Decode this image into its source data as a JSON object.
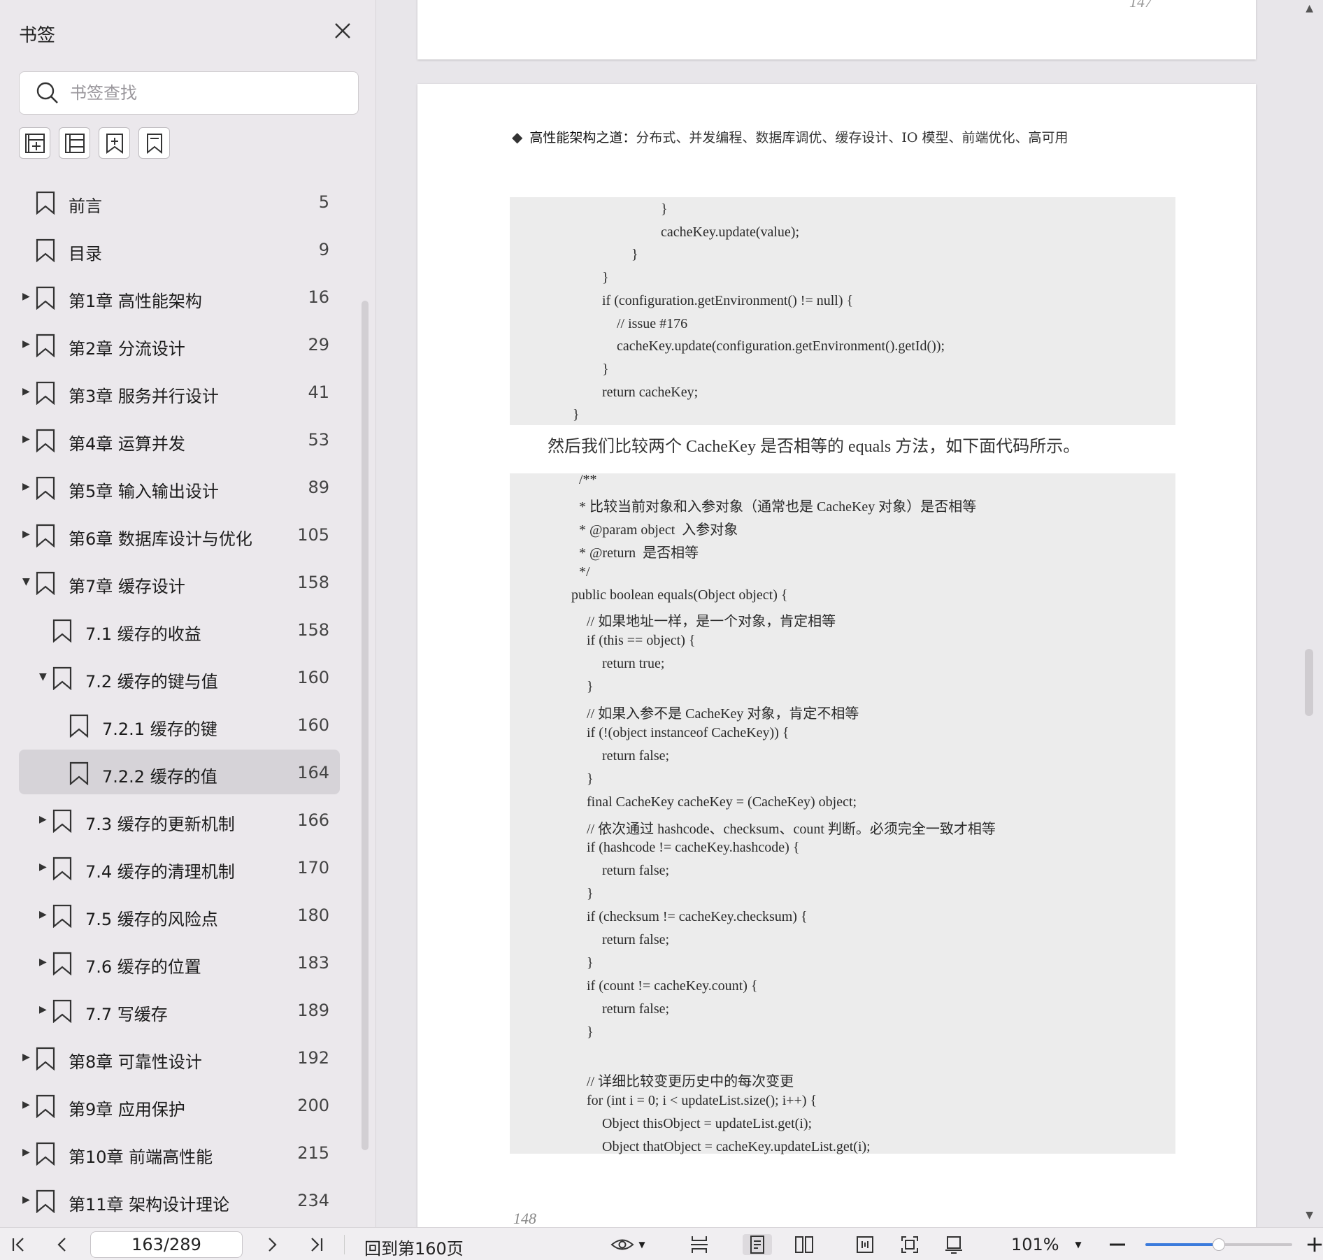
{
  "sidebar": {
    "title": "书签",
    "search_placeholder": "书签查找",
    "tools": [
      "add-bookmark-icon",
      "collapse-all-icon",
      "expand-all-icon",
      "bookmark-icon"
    ],
    "items": [
      {
        "label": "前言",
        "page": "5",
        "level": 0,
        "arrow": "none"
      },
      {
        "label": "目录",
        "page": "9",
        "level": 0,
        "arrow": "none"
      },
      {
        "label": "第1章 高性能架构",
        "page": "16",
        "level": 0,
        "arrow": "right"
      },
      {
        "label": "第2章 分流设计",
        "page": "29",
        "level": 0,
        "arrow": "right"
      },
      {
        "label": "第3章 服务并行设计",
        "page": "41",
        "level": 0,
        "arrow": "right"
      },
      {
        "label": "第4章 运算并发",
        "page": "53",
        "level": 0,
        "arrow": "right"
      },
      {
        "label": "第5章 输入输出设计",
        "page": "89",
        "level": 0,
        "arrow": "right"
      },
      {
        "label": "第6章 数据库设计与优化",
        "page": "105",
        "level": 0,
        "arrow": "right"
      },
      {
        "label": "第7章 缓存设计",
        "page": "158",
        "level": 0,
        "arrow": "down"
      },
      {
        "label": "7.1 缓存的收益",
        "page": "158",
        "level": 1,
        "arrow": "none"
      },
      {
        "label": "7.2 缓存的键与值",
        "page": "160",
        "level": 1,
        "arrow": "down"
      },
      {
        "label": "7.2.1 缓存的键",
        "page": "160",
        "level": 2,
        "arrow": "none"
      },
      {
        "label": "7.2.2 缓存的值",
        "page": "164",
        "level": 2,
        "arrow": "none",
        "active": true
      },
      {
        "label": "7.3 缓存的更新机制",
        "page": "166",
        "level": 1,
        "arrow": "right"
      },
      {
        "label": "7.4 缓存的清理机制",
        "page": "170",
        "level": 1,
        "arrow": "right"
      },
      {
        "label": "7.5 缓存的风险点",
        "page": "180",
        "level": 1,
        "arrow": "right"
      },
      {
        "label": "7.6 缓存的位置",
        "page": "183",
        "level": 1,
        "arrow": "right"
      },
      {
        "label": "7.7 写缓存",
        "page": "189",
        "level": 1,
        "arrow": "right"
      },
      {
        "label": "第8章 可靠性设计",
        "page": "192",
        "level": 0,
        "arrow": "right"
      },
      {
        "label": "第9章 应用保护",
        "page": "200",
        "level": 0,
        "arrow": "right"
      },
      {
        "label": "第10章 前端高性能",
        "page": "215",
        "level": 0,
        "arrow": "right"
      },
      {
        "label": "第11章 架构设计理论",
        "page": "234",
        "level": 0,
        "arrow": "right"
      }
    ]
  },
  "document": {
    "prev_page_number": "147",
    "header_bold": "高性能架构之道：",
    "header_rest": "分布式、并发编程、数据库调优、缓存设计、IO 模型、前端优化、高可用",
    "code_block_1": [
      {
        "t": "}",
        "i": 6
      },
      {
        "t": "cacheKey.update(value);",
        "i": 6
      },
      {
        "t": "}",
        "i": 4
      },
      {
        "t": "}",
        "i": 2
      },
      {
        "t": "if (configuration.getEnvironment() != null) {",
        "i": 2
      },
      {
        "t": "// issue #176",
        "i": 3
      },
      {
        "t": "cacheKey.update(configuration.getEnvironment().getId());",
        "i": 3
      },
      {
        "t": "}",
        "i": 2
      },
      {
        "t": "return cacheKey;",
        "i": 2
      },
      {
        "t": "}",
        "i": 0
      }
    ],
    "paragraph": "然后我们比较两个 CacheKey 是否相等的 equals 方法，如下面代码所示。",
    "code_block_2": [
      {
        "t": "/**",
        "i": 0.5
      },
      {
        "t": "* 比较当前对象和入参对象（通常也是 CacheKey 对象）是否相等",
        "i": 0.5
      },
      {
        "t": "* @param object  入参对象",
        "i": 0.5
      },
      {
        "t": "* @return  是否相等",
        "i": 0.5
      },
      {
        "t": "*/",
        "i": 0.5
      },
      {
        "t": "public boolean equals(Object object) {",
        "i": 0
      },
      {
        "t": "// 如果地址一样，是一个对象，肯定相等",
        "i": 1
      },
      {
        "t": "if (this == object) {",
        "i": 1
      },
      {
        "t": "return true;",
        "i": 2
      },
      {
        "t": "}",
        "i": 1
      },
      {
        "t": "// 如果入参不是 CacheKey 对象，肯定不相等",
        "i": 1
      },
      {
        "t": "if (!(object instanceof CacheKey)) {",
        "i": 1
      },
      {
        "t": "return false;",
        "i": 2
      },
      {
        "t": "}",
        "i": 1
      },
      {
        "t": "final CacheKey cacheKey = (CacheKey) object;",
        "i": 1
      },
      {
        "t": "// 依次通过 hashcode、checksum、count 判断。必须完全一致才相等",
        "i": 1
      },
      {
        "t": "if (hashcode != cacheKey.hashcode) {",
        "i": 1
      },
      {
        "t": "return false;",
        "i": 2
      },
      {
        "t": "}",
        "i": 1
      },
      {
        "t": "if (checksum != cacheKey.checksum) {",
        "i": 1
      },
      {
        "t": "return false;",
        "i": 2
      },
      {
        "t": "}",
        "i": 1
      },
      {
        "t": "if (count != cacheKey.count) {",
        "i": 1
      },
      {
        "t": "return false;",
        "i": 2
      },
      {
        "t": "}",
        "i": 1
      },
      {
        "t": "",
        "i": 0
      },
      {
        "t": "// 详细比较变更历史中的每次变更",
        "i": 1
      },
      {
        "t": "for (int i = 0; i < updateList.size(); i++) {",
        "i": 1
      },
      {
        "t": "Object thisObject = updateList.get(i);",
        "i": 2
      },
      {
        "t": "Object thatObject = cacheKey.updateList.get(i);",
        "i": 2
      }
    ],
    "page_number": "148"
  },
  "toolbar": {
    "page_indicator": "163/289",
    "goto_label": "回到第160页",
    "zoom": "101%",
    "zoom_level_fraction": 0.5
  }
}
